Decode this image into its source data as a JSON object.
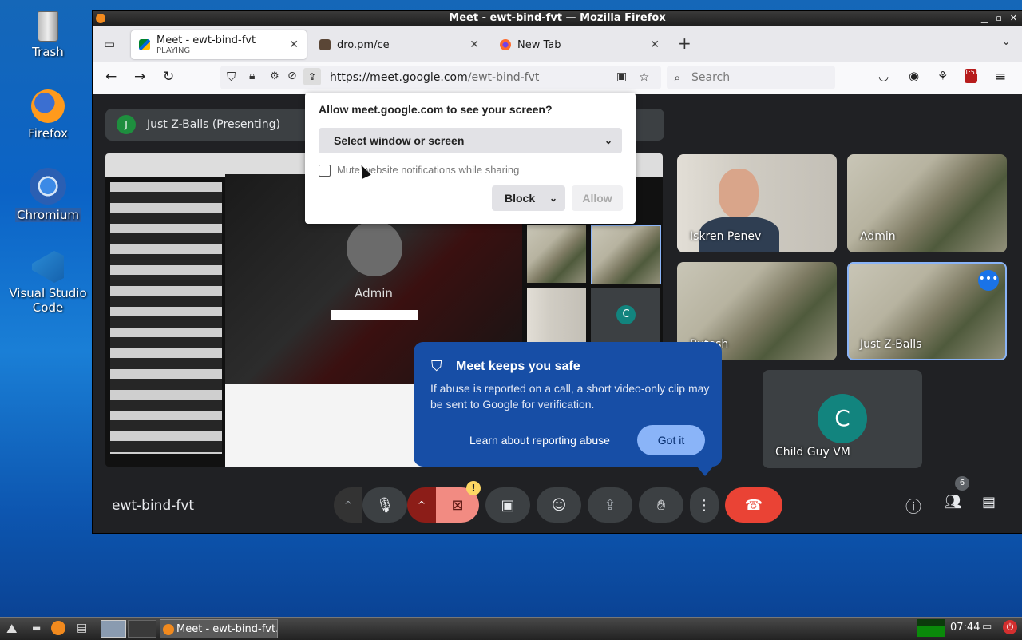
{
  "desktop": {
    "icons": [
      {
        "label": "Trash"
      },
      {
        "label": "Firefox"
      },
      {
        "label": "Chromium"
      },
      {
        "label": "Visual Studio Code"
      }
    ]
  },
  "window": {
    "title": "Meet - ewt-bind-fvt — Mozilla Firefox"
  },
  "tabs": [
    {
      "label": "Meet - ewt-bind-fvt",
      "sublabel": "PLAYING",
      "close": "✕"
    },
    {
      "label": "dro.pm/ce",
      "close": "✕"
    },
    {
      "label": "New Tab",
      "close": "✕"
    }
  ],
  "nav": {
    "new_tab": "+",
    "url_host": "https://meet.google.com",
    "url_path": "/ewt-bind-fvt",
    "search_placeholder": "Search",
    "badge_count": "1:51"
  },
  "permission": {
    "question": "Allow meet.google.com to see your screen?",
    "select_label": "Select window or screen",
    "mute_label": "Mute website notifications while sharing",
    "block_label": "Block",
    "allow_label": "Allow"
  },
  "meet": {
    "presenting_initial": "J",
    "presenting_label": "Just Z-Balls (Presenting)",
    "meeting_name": "ewt-bind-fvt",
    "participants_count": "6",
    "tiles": [
      {
        "name": "Iskren Penev"
      },
      {
        "name": "Admin"
      },
      {
        "name": "Rutesh"
      },
      {
        "name": "Just Z-Balls"
      },
      {
        "name": "Child Guy VM",
        "initial": "C"
      }
    ],
    "shared_screen": {
      "admin_label": "Admin",
      "mini_initial": "C"
    }
  },
  "safety": {
    "title": "Meet keeps you safe",
    "body": "If abuse is reported on a call, a short video-only clip may be sent to Google for verification.",
    "link": "Learn about reporting abuse",
    "button": "Got it"
  },
  "taskbar": {
    "task_label": "Meet - ewt-bind-fvt...",
    "clock": "07:44"
  },
  "colors": {
    "meet_bg": "#202124",
    "end_call": "#ea4335",
    "safety_card": "#174ea6",
    "accent_blue": "#8ab4f8"
  }
}
